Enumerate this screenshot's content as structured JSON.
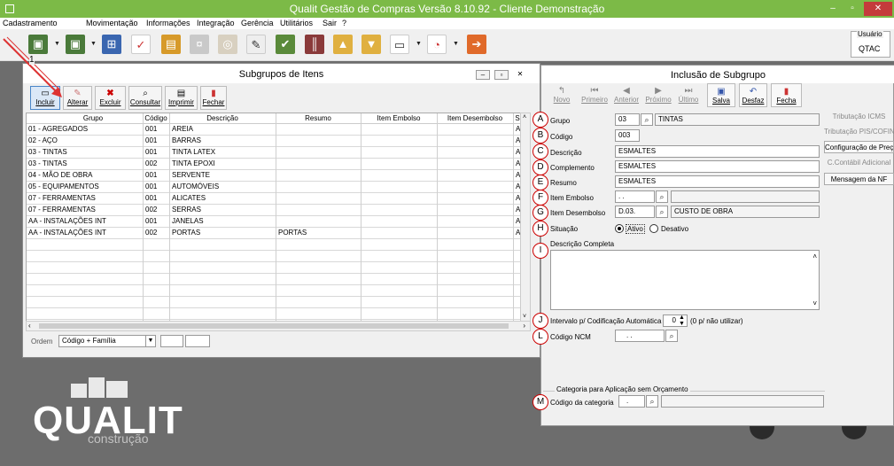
{
  "app": {
    "title": "Qualit Gestão de Compras Versão 8.10.92 - Cliente Demonstração",
    "min": "–",
    "max": "▫",
    "close": "✕"
  },
  "menu": [
    "Cadastramento",
    "Movimentação",
    "Informações",
    "Integração",
    "Gerência",
    "Utilitários",
    "Sair",
    "?"
  ],
  "user": {
    "label": "Usuário",
    "value": "QTAC"
  },
  "annotation_number": "1",
  "subgrupos": {
    "title": "Subgrupos de Itens",
    "buttons": [
      "Incluir",
      "Alterar",
      "Excluir",
      "Consultar",
      "Imprimir",
      "Fechar"
    ],
    "columns": [
      "Grupo",
      "Código",
      "Descrição",
      "Resumo",
      "Item Embolso",
      "Item Desembolso",
      "S"
    ],
    "rows": [
      [
        "01 - AGREGADOS",
        "001",
        "AREIA",
        "",
        "",
        "",
        "A"
      ],
      [
        "02 - AÇO",
        "001",
        "BARRAS",
        "",
        "",
        "",
        "A"
      ],
      [
        "03 - TINTAS",
        "001",
        "TINTA LATEX",
        "",
        "",
        "",
        "A"
      ],
      [
        "03 - TINTAS",
        "002",
        "TINTA EPOXI",
        "",
        "",
        "",
        "A"
      ],
      [
        "04 - MÃO DE OBRA",
        "001",
        "SERVENTE",
        "",
        "",
        "",
        "A"
      ],
      [
        "05 - EQUIPAMENTOS",
        "001",
        "AUTOMÓVEIS",
        "",
        "",
        "",
        "A"
      ],
      [
        "07 - FERRAMENTAS",
        "001",
        "ALICATES",
        "",
        "",
        "",
        "A"
      ],
      [
        "07 - FERRAMENTAS",
        "002",
        "SERRAS",
        "",
        "",
        "",
        "A"
      ],
      [
        "AA - INSTALAÇÕES INT",
        "001",
        "JANELAS",
        "",
        "",
        "",
        "A"
      ],
      [
        "AA - INSTALAÇÕES INT",
        "002",
        "PORTAS",
        "PORTAS",
        "",
        "",
        "A"
      ]
    ],
    "order_label": "Ordem",
    "order_value": "Código + Família"
  },
  "inclusao": {
    "title": "Inclusão de Subgrupo",
    "buttons": [
      "Novo",
      "Primeiro",
      "Anterior",
      "Próximo",
      "Último",
      "Salva",
      "Desfaz",
      "Fecha"
    ],
    "fields": {
      "grupo": {
        "label": "Grupo",
        "code": "03",
        "desc": "TINTAS",
        "marker": "A"
      },
      "codigo": {
        "label": "Código",
        "value": "003",
        "marker": "B"
      },
      "descricao": {
        "label": "Descrição",
        "value": "ESMALTES",
        "marker": "C"
      },
      "complemento": {
        "label": "Complemento",
        "value": "ESMALTES",
        "marker": "D"
      },
      "resumo": {
        "label": "Resumo",
        "value": "ESMALTES",
        "marker": "E"
      },
      "item_embolso": {
        "label": "Item Embolso",
        "value": ". .",
        "marker": "F"
      },
      "item_desembolso": {
        "label": "Item Desembolso",
        "value": "D.03.",
        "desc": "CUSTO DE OBRA",
        "marker": "G"
      },
      "situacao": {
        "label": "Situação",
        "opt1": "Ativo",
        "opt2": "Desativo",
        "marker": "H"
      },
      "descricao_completa": {
        "label": "Descrição Completa",
        "marker": "I"
      },
      "intervalo": {
        "label": "Intervalo p/ Codificação Automática",
        "value": "0",
        "hint": "(0 p/ não utilizar)",
        "marker": "J"
      },
      "ncm": {
        "label": "Código NCM",
        "value": ". .",
        "marker": "L"
      },
      "categoria_section": "Categoria para Aplicação sem Orçamento",
      "categoria": {
        "label": "Código da categoria",
        "value": ".",
        "marker": "M"
      }
    }
  },
  "side_buttons": [
    "Tributação ICMS",
    "Tributação PIS/COFINS",
    "Configuração de Preços",
    "C.Contábil Adicional",
    "Mensagem da NF"
  ],
  "logo": {
    "main": "QUALIT",
    "sub": "construção"
  }
}
